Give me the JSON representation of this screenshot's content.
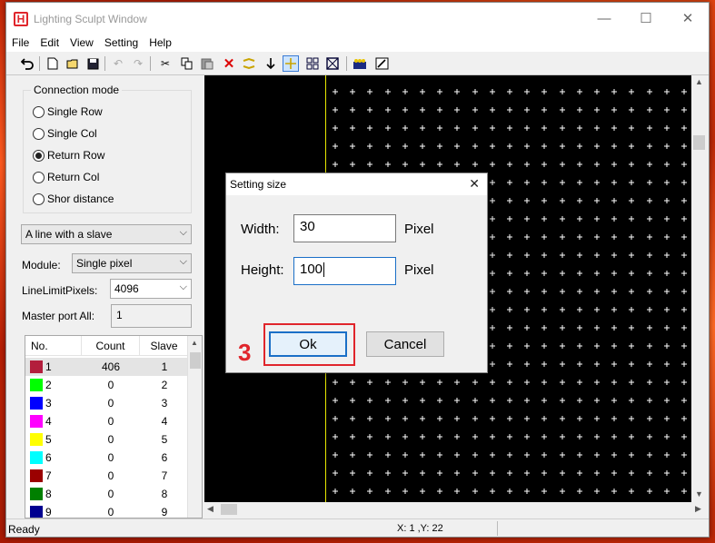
{
  "window": {
    "title": "Lighting Sculpt Window",
    "icon_letter": "H",
    "controls": {
      "minimize": "—",
      "maximize": "☐",
      "close": "✕"
    }
  },
  "menu": [
    "File",
    "Edit",
    "View",
    "Setting",
    "Help"
  ],
  "toolbar": {
    "icons": [
      "undo-arrow-icon",
      "new-file-icon",
      "open-folder-icon",
      "save-icon",
      "undo-icon",
      "redo-icon",
      "cut-icon",
      "copy-icon",
      "paste-icon",
      "delete-icon",
      "connect-icon",
      "down-arrow-icon",
      "crosshair-icon",
      "grid-icon",
      "select-box-icon",
      "lights-icon",
      "edit-icon"
    ],
    "selected": "crosshair-icon"
  },
  "connection_mode": {
    "title": "Connection mode",
    "options": [
      "Single Row",
      "Single Col",
      "Return Row",
      "Return Col",
      "Shor distance"
    ],
    "selected_index": 2
  },
  "line_slave_select": {
    "value": "A line with a slave"
  },
  "module": {
    "label": "Module:",
    "value": "Single pixel"
  },
  "line_limit": {
    "label": "LineLimitPixels:",
    "value": "4096"
  },
  "master_port": {
    "label": "Master port All:",
    "value": "1"
  },
  "list": {
    "headers": [
      "No.",
      "Count",
      "Slave"
    ],
    "rows": [
      {
        "no": "1",
        "count": "406",
        "slave": "1",
        "color": "#b31e3c"
      },
      {
        "no": "2",
        "count": "0",
        "slave": "2",
        "color": "#00ff00"
      },
      {
        "no": "3",
        "count": "0",
        "slave": "3",
        "color": "#0000ff"
      },
      {
        "no": "4",
        "count": "0",
        "slave": "4",
        "color": "#ff00ff"
      },
      {
        "no": "5",
        "count": "0",
        "slave": "5",
        "color": "#ffff00"
      },
      {
        "no": "6",
        "count": "0",
        "slave": "6",
        "color": "#00ffff"
      },
      {
        "no": "7",
        "count": "0",
        "slave": "7",
        "color": "#9b0000"
      },
      {
        "no": "8",
        "count": "0",
        "slave": "8",
        "color": "#008000"
      },
      {
        "no": "9",
        "count": "0",
        "slave": "9",
        "color": "#000090"
      }
    ]
  },
  "status": {
    "text": "Ready",
    "coords": "X: 1 ,Y: 22"
  },
  "dialog": {
    "title": "Setting size",
    "close": "✕",
    "width_label": "Width:",
    "width_value": "30",
    "height_label": "Height:",
    "height_value": "100",
    "unit": "Pixel",
    "ok_label": "Ok",
    "cancel_label": "Cancel"
  },
  "annotation": {
    "step": "3",
    "color": "#e0252b"
  }
}
